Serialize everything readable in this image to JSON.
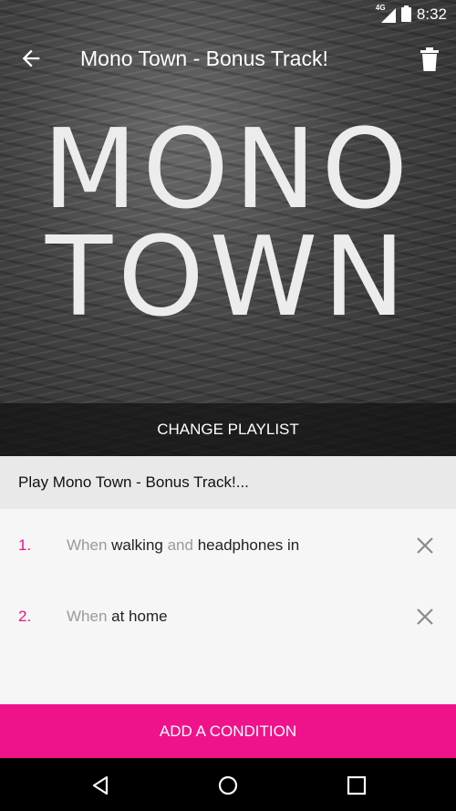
{
  "status_bar": {
    "network": "4G",
    "time": "8:32"
  },
  "app_bar": {
    "title": "Mono Town - Bonus Track!"
  },
  "album_art": {
    "line1": "MONO",
    "line2": "TOWN"
  },
  "change_playlist_label": "CHANGE PLAYLIST",
  "summary": "Play Mono Town - Bonus Track!...",
  "conditions": [
    {
      "number": "1.",
      "when": "When",
      "place": "walking",
      "and": "and",
      "extra": "headphones in"
    },
    {
      "number": "2.",
      "when": "When",
      "place": "at home"
    }
  ],
  "add_condition_label": "ADD A CONDITION",
  "colors": {
    "accent": "#f0128a",
    "number": "#e8158c"
  },
  "icons": [
    "back-arrow-icon",
    "trash-icon",
    "close-icon",
    "nav-back-icon",
    "nav-home-icon",
    "nav-recents-icon"
  ]
}
